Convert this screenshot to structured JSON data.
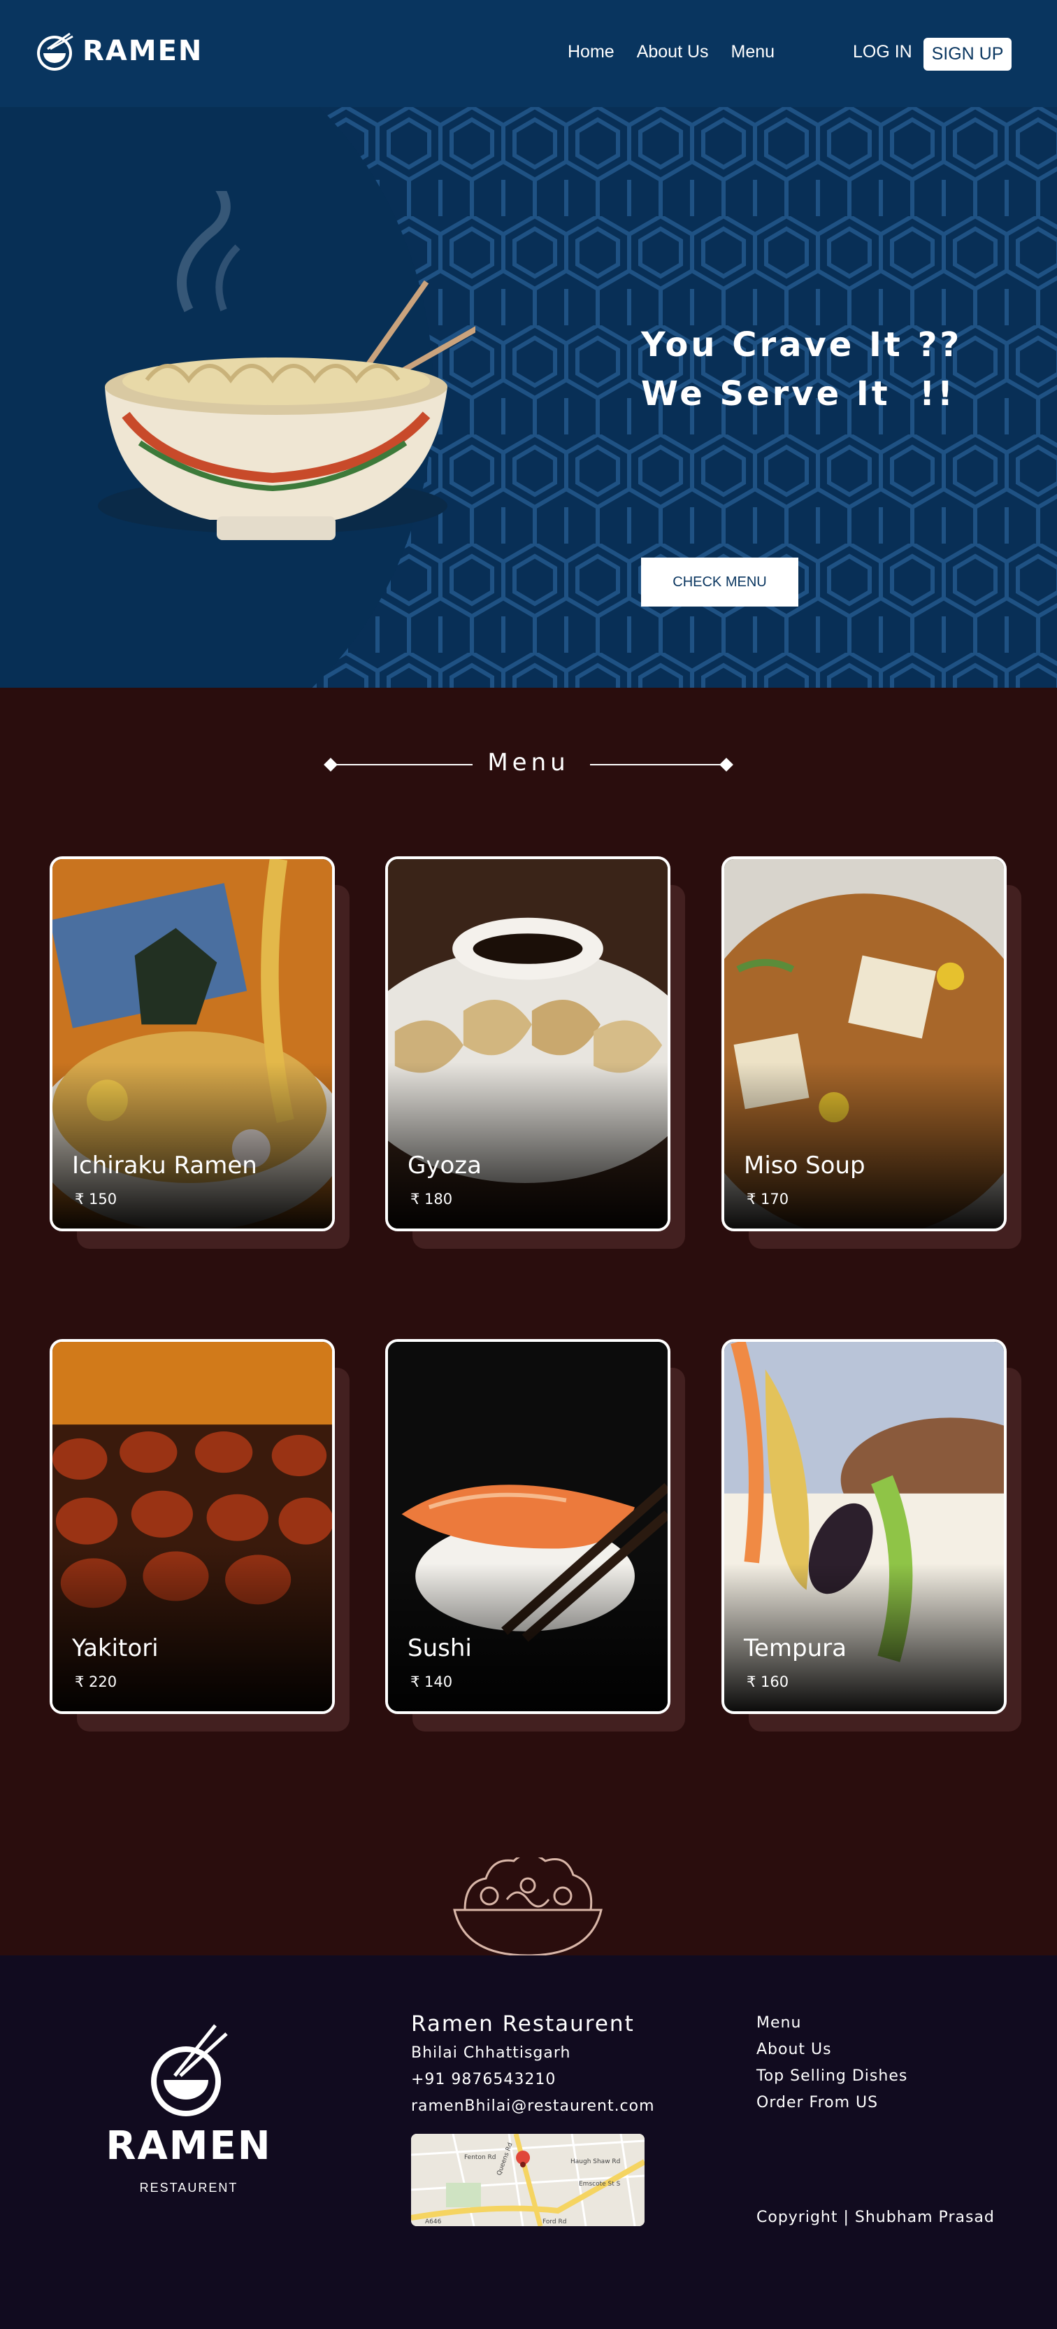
{
  "header": {
    "brand": "RAMEN",
    "nav": [
      "Home",
      "About Us",
      "Menu"
    ],
    "login_label": "LOG IN",
    "signup_label": "SIGN UP"
  },
  "hero": {
    "line1": "You Crave It ??",
    "line2": "We Serve It  !!",
    "cta_label": "CHECK MENU"
  },
  "menu": {
    "title": "Menu",
    "items": [
      {
        "name": "Ichiraku Ramen",
        "price": "₹ 150"
      },
      {
        "name": "Gyoza",
        "price": "₹ 180"
      },
      {
        "name": "Miso Soup",
        "price": "₹ 170"
      },
      {
        "name": "Yakitori",
        "price": "₹ 220"
      },
      {
        "name": "Sushi",
        "price": "₹ 140"
      },
      {
        "name": "Tempura",
        "price": "₹ 160"
      }
    ]
  },
  "footer": {
    "brand": "RAMEN",
    "brand_sub": "RESTAURENT",
    "restaurant_name": "Ramen Restaurent",
    "address": "Bhilai Chhattisgarh",
    "phone": "+91 9876543210",
    "email": "ramenBhilai@restaurent.com",
    "map_labels": [
      "Fenton Rd",
      "Queens Rd",
      "Haugh Shaw Rd",
      "Emscote St S",
      "A646",
      "Ford Rd"
    ],
    "links": [
      "Menu",
      "About Us",
      "Top Selling Dishes",
      "Order From US"
    ],
    "copyright": "Copyright | Shubham Prasad"
  },
  "colors": {
    "header_bg": "#09355f",
    "menu_bg": "#2a0d0d",
    "footer_bg": "#110b1f"
  },
  "icons": [
    "ramen-bowl-icon",
    "salad-bowl-icon",
    "map-pin-icon"
  ]
}
